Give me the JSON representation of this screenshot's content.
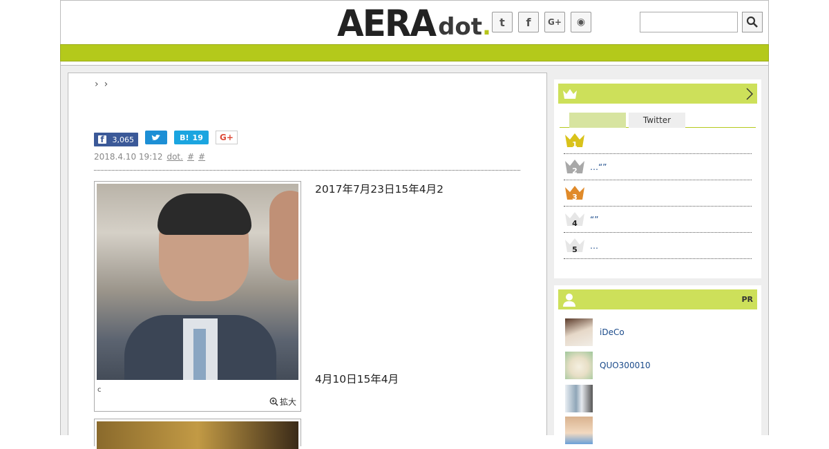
{
  "header": {
    "logo_main": "AERA",
    "logo_sub": "dot",
    "logo_period": ".",
    "social": [
      {
        "name": "twitter-icon",
        "glyph": "t"
      },
      {
        "name": "facebook-icon",
        "glyph": "f"
      },
      {
        "name": "googleplus-icon",
        "glyph": "G+"
      },
      {
        "name": "rss-icon",
        "glyph": "◉"
      }
    ],
    "search_placeholder": ""
  },
  "article": {
    "breadcrumb": [
      "›",
      "›"
    ],
    "share": {
      "fb_count": "3,065",
      "hb_label": "B!",
      "hb_count": "19",
      "gplus_label": "G+"
    },
    "meta": {
      "date": "2018.4.10 19:12",
      "source": "dot.",
      "tag1": "#",
      "tag2": "#"
    },
    "photo_caption": "c",
    "zoom_label": "拡大",
    "paragraphs": [
      "２０１７年７月２３日２０１５年４月２",
      "",
      "",
      "４月１０日１５年４月"
    ],
    "paragraph_lines": {
      "p1": "2017年7月23日15年4月2",
      "p2": "",
      "p3": "",
      "p4": "4月10日15年4月"
    }
  },
  "ranking": {
    "tabs": [
      {
        "label": ""
      },
      {
        "label": "Twitter"
      }
    ],
    "items": [
      {
        "rank": "1",
        "title": "",
        "color": "#d9c21a"
      },
      {
        "rank": "2",
        "title": "…“”",
        "color": "#a8a8a8"
      },
      {
        "rank": "3",
        "title": "",
        "color": "#e08a2a"
      },
      {
        "rank": "4",
        "title": "“”",
        "color": "#e6e6e6"
      },
      {
        "rank": "5",
        "title": "…",
        "color": "#e6e6e6"
      }
    ]
  },
  "pr": {
    "label": "PR",
    "items": [
      {
        "title": "iDeCo"
      },
      {
        "title": "QUO300010"
      },
      {
        "title": ""
      },
      {
        "title": ""
      }
    ]
  },
  "colors": {
    "accent": "#b4c91b",
    "side_head": "#cde05a",
    "link": "#1a4a8a"
  }
}
